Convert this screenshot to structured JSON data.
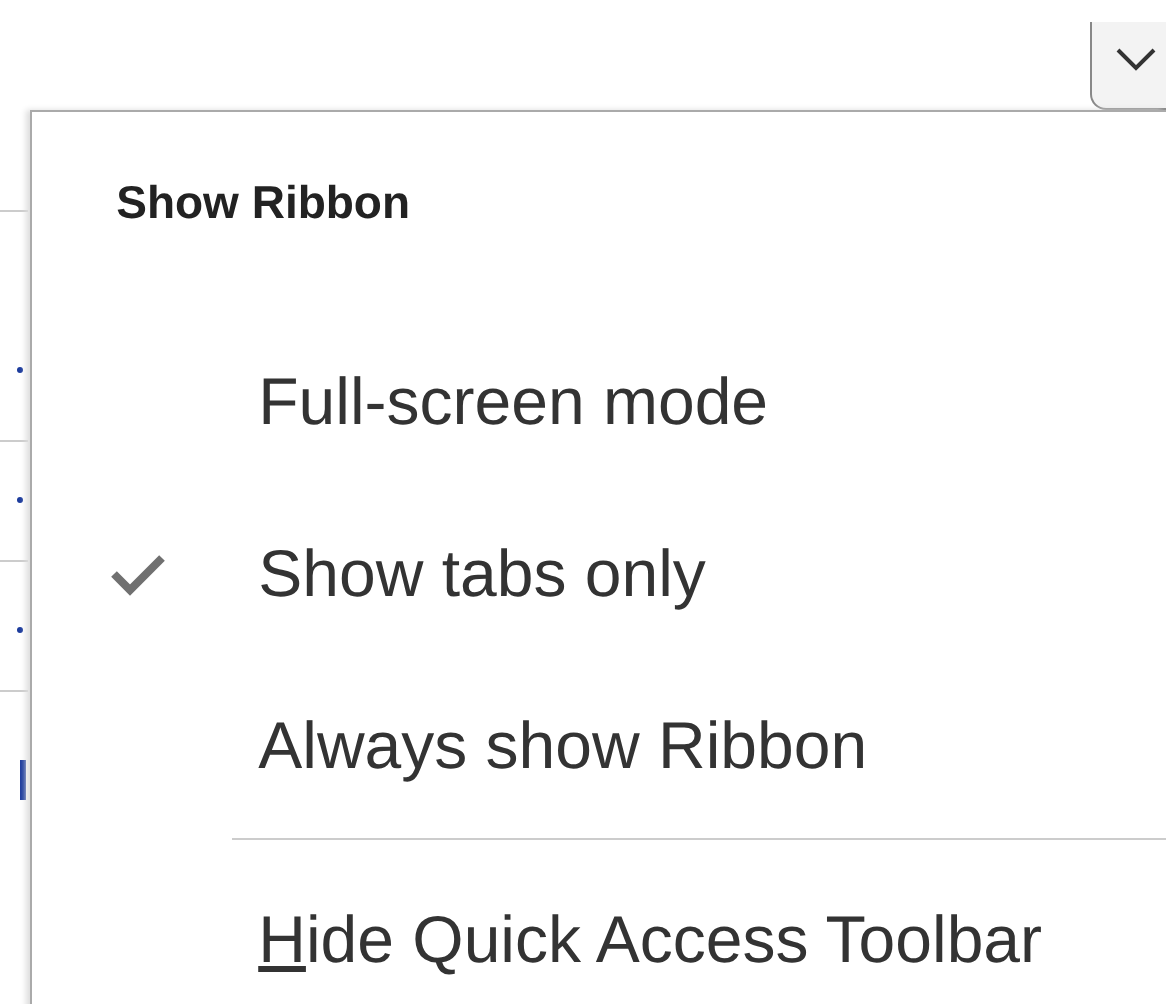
{
  "menu": {
    "title": "Show Ribbon",
    "items": [
      {
        "label": "Full-screen mode",
        "checked": false,
        "mnemonic": false
      },
      {
        "label": "Show tabs only",
        "checked": true,
        "mnemonic": false
      },
      {
        "label": "Always show Ribbon",
        "checked": false,
        "mnemonic": false,
        "divider_after": true
      },
      {
        "label": "Hide Quick Access Toolbar",
        "checked": false,
        "mnemonic": true
      }
    ]
  }
}
